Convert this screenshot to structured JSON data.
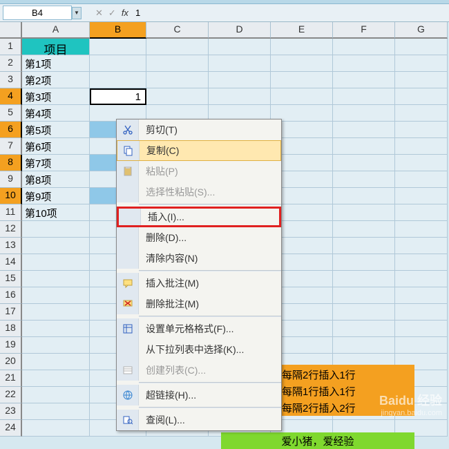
{
  "namebox": "B4",
  "formula_value": "1",
  "fx_label": "fx",
  "columns": [
    "A",
    "B",
    "C",
    "D",
    "E",
    "F",
    "G"
  ],
  "row_numbers": [
    1,
    2,
    3,
    4,
    5,
    6,
    7,
    8,
    9,
    10,
    11,
    12,
    13,
    14,
    15,
    16,
    17,
    18,
    19,
    20,
    21,
    22,
    23,
    24
  ],
  "selected_row_headers": [
    4,
    6,
    8,
    10
  ],
  "header_a1": "项目",
  "items": [
    "第1项",
    "第2项",
    "第3项",
    "第4项",
    "第5项",
    "第6项",
    "第7项",
    "第8项",
    "第9项",
    "第10项"
  ],
  "b4_value": "1",
  "orange_lines": [
    "每隔2行插入1行",
    "每隔1行插入1行",
    "每隔2行插入2行"
  ],
  "green_text": "爱小猪，爱经验",
  "menu": {
    "cut": "剪切(T)",
    "copy": "复制(C)",
    "paste": "粘贴(P)",
    "paste_special": "选择性粘贴(S)...",
    "insert": "插入(I)...",
    "delete": "删除(D)...",
    "clear": "清除内容(N)",
    "insert_comment": "插入批注(M)",
    "delete_comment": "删除批注(M)",
    "format_cells": "设置单元格格式(F)...",
    "dropdown_list": "从下拉列表中选择(K)...",
    "create_list": "创建列表(C)...",
    "hyperlink": "超链接(H)...",
    "lookup": "查阅(L)..."
  },
  "watermark": "Baidu 经验",
  "watermark_sub": "jingyan.baidu.com"
}
